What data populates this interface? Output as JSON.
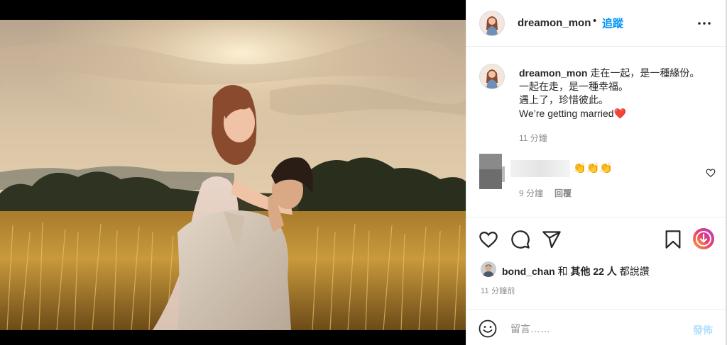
{
  "post": {
    "username": "dreamon_mon",
    "dot": "•",
    "follow_label": "追蹤",
    "more_icon": "more-horizontal-icon"
  },
  "caption": {
    "username": "dreamon_mon",
    "lines": [
      "走在一起，是一種緣份。",
      "一起在走，是一種幸福。",
      "遇上了，珍惜彼此。",
      "We’re getting married❤️"
    ],
    "time": "11 分鐘"
  },
  "comment": {
    "text": "👏👏👏",
    "time": "9 分鐘",
    "reply_label": "回覆"
  },
  "likes": {
    "username": "bond_chan",
    "and": "和",
    "others": "其他 22 人",
    "suffix": "都說讚"
  },
  "post_time": "11 分鐘前",
  "comment_bar": {
    "placeholder": "留言……",
    "post_label": "發佈"
  },
  "colors": {
    "accent": "#0095f6",
    "post_disabled": "#b2dffc",
    "heart": "#ed1c35"
  }
}
